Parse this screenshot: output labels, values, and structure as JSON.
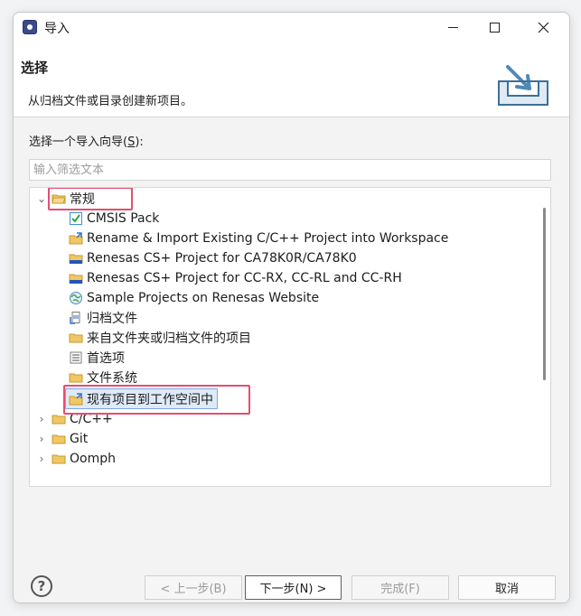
{
  "window": {
    "title": "导入"
  },
  "header": {
    "title": "选择",
    "description": "从归档文件或目录创建新项目。"
  },
  "wizard": {
    "label_prefix": "选择一个导入向导(",
    "label_hotkey": "S",
    "label_suffix": "):",
    "filter_placeholder": "输入筛选文本"
  },
  "tree": {
    "items": [
      {
        "label": "常规",
        "icon": "folder-open-icon"
      },
      {
        "label": "CMSIS Pack",
        "icon": "cmsis-check-icon"
      },
      {
        "label": "Rename & Import Existing C/C++ Project into Workspace",
        "icon": "rename-import-icon"
      },
      {
        "label": "Renesas CS+ Project for CA78K0R/CA78K0",
        "icon": "renesas-folder-icon"
      },
      {
        "label": "Renesas CS+ Project for CC-RX, CC-RL and CC-RH",
        "icon": "renesas-folder-icon"
      },
      {
        "label": "Sample Projects on Renesas Website",
        "icon": "globe-icon"
      },
      {
        "label": "归档文件",
        "icon": "archive-file-icon"
      },
      {
        "label": "来自文件夹或归档文件的项目",
        "icon": "folder-icon"
      },
      {
        "label": "首选项",
        "icon": "preferences-icon"
      },
      {
        "label": "文件系统",
        "icon": "folder-icon"
      },
      {
        "label": "现有项目到工作空间中",
        "icon": "workspace-project-icon"
      },
      {
        "label": "C/C++",
        "icon": "folder-icon"
      },
      {
        "label": "Git",
        "icon": "folder-icon"
      },
      {
        "label": "Oomph",
        "icon": "folder-icon"
      }
    ]
  },
  "footer": {
    "help": "?",
    "prev": "< 上一步(B)",
    "next": "下一步(N) >",
    "finish": "完成(F)",
    "cancel": "取消"
  },
  "colors": {
    "highlight": "#e34f71",
    "selected_bg": "#dfeaf9",
    "selected_border": "#7ea7db",
    "folder": "#e9b84f"
  }
}
